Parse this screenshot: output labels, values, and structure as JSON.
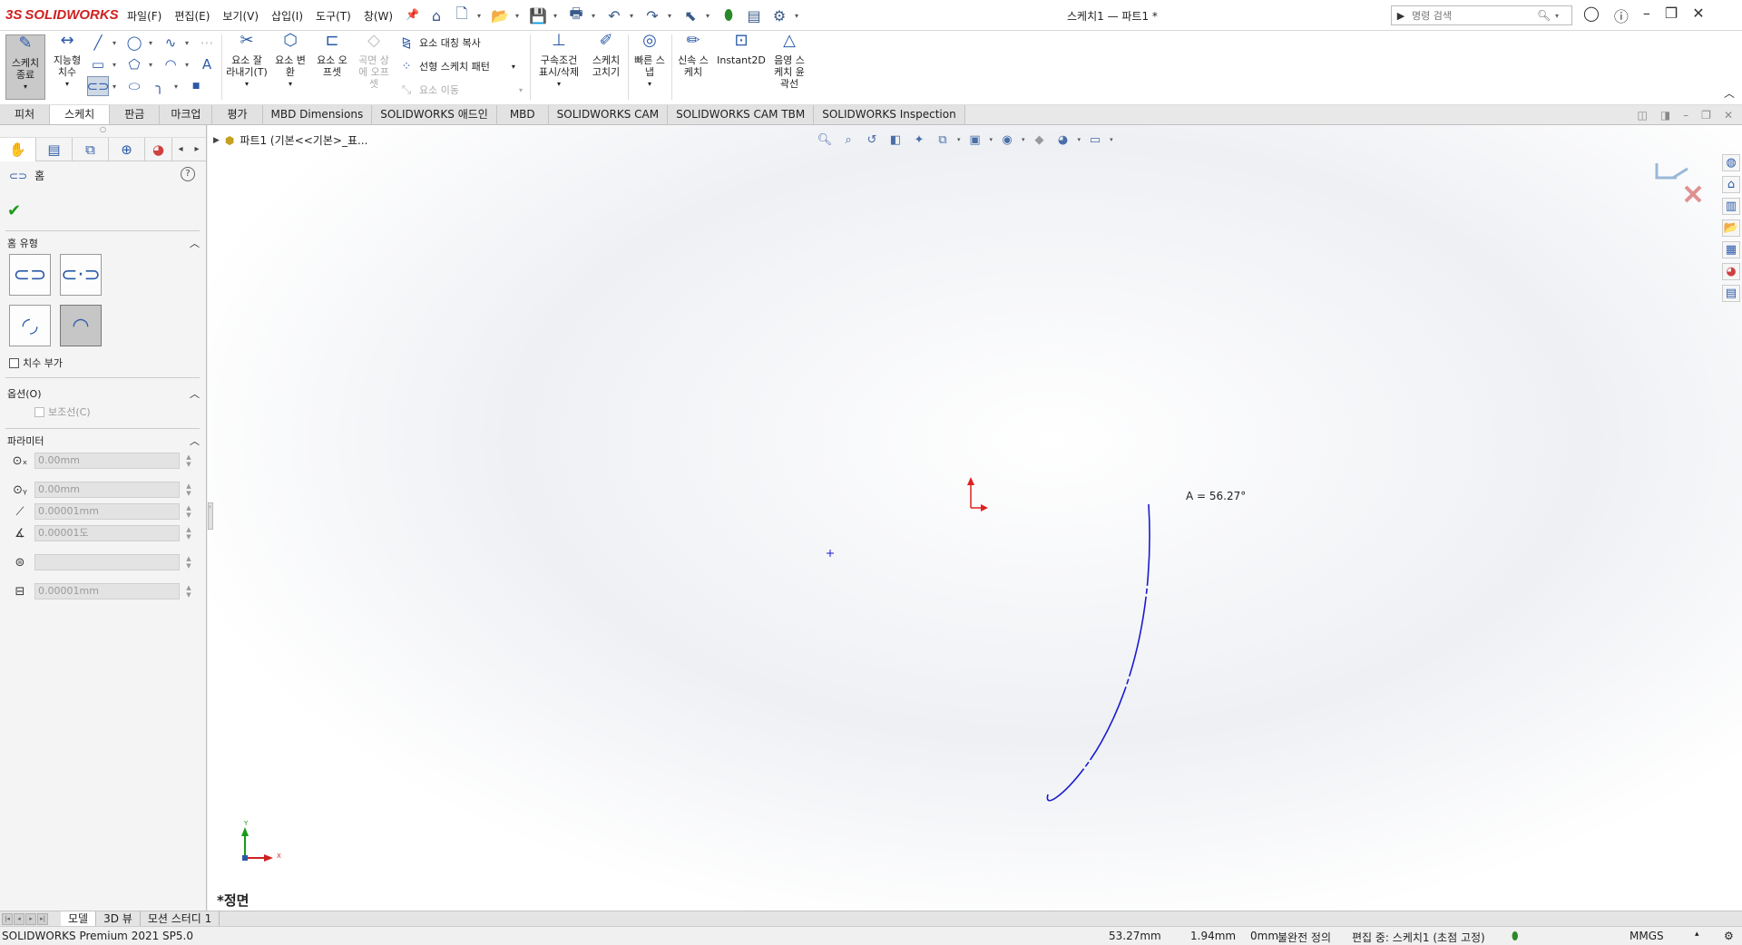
{
  "app": {
    "logo_ds": "3S",
    "logo_text": "SOLIDWORKS",
    "menus": [
      "파일(F)",
      "편집(E)",
      "보기(V)",
      "삽입(I)",
      "도구(T)",
      "창(W)"
    ],
    "document_title": "스케치1 — 파트1 *",
    "search_placeholder": "명령 검색"
  },
  "ribbon": {
    "exit_sketch": "스케치\n종료",
    "smart_dim": "지능형\n치수",
    "trim": "요소 잘\n라내기(T)",
    "convert": "요소 변\n환",
    "offset": "요소 오\n프셋",
    "surface_offset": "곡면 상\n에 오프\n셋",
    "mirror": "요소 대칭 복사",
    "linear_pattern": "선형 스케치 패턴",
    "move": "요소 이동",
    "relations": "구속조건\n표시/삭제",
    "repair": "스케치\n고치기",
    "quick_snap": "빠른 스\n냅",
    "rapid_sketch": "신속 스\n케치",
    "instant2d": "Instant2D",
    "shaded_contours": "음영 스\n케치 윤\n곽선"
  },
  "tabs": [
    "피처",
    "스케치",
    "판금",
    "마크업",
    "평가",
    "MBD Dimensions",
    "SOLIDWORKS 애드인",
    "MBD",
    "SOLIDWORKS CAM",
    "SOLIDWORKS CAM TBM",
    "SOLIDWORKS Inspection"
  ],
  "active_tab": "스케치",
  "property_manager": {
    "title": "홈",
    "help": "?",
    "ok": "✔",
    "slot_type_header": "홈 유형",
    "add_dimensions": "치수 부가",
    "options_header": "옵션(O)",
    "construction": "보조선(C)",
    "parameters_header": "파라미터",
    "params": [
      {
        "icon": "x-center-icon",
        "value": "0.00mm"
      },
      {
        "icon": "y-center-icon",
        "value": "0.00mm"
      },
      {
        "icon": "radius-icon",
        "value": "0.00001mm"
      },
      {
        "icon": "angle-icon",
        "value": "0.00001도"
      },
      {
        "icon": "width-icon",
        "value": ""
      },
      {
        "icon": "length-icon",
        "value": "0.00001mm"
      }
    ]
  },
  "graphics": {
    "breadcrumb": "파트1  (기본<<기본>_표...",
    "angle_label": "A = 56.27°",
    "view_name": "*정면",
    "triad_y": "Y",
    "triad_x": "X"
  },
  "bottom_tabs": [
    "모델",
    "3D 뷰",
    "모션 스터디 1"
  ],
  "status": {
    "edition": "SOLIDWORKS Premium 2021 SP5.0",
    "x": "53.27mm",
    "y": "1.94mm",
    "z": "0mm",
    "definition": "불완전 정의",
    "editing": "편집 중: 스케치1 (초점 고정)",
    "units": "MMGS"
  },
  "colors": {
    "sketch_line": "#1a1ad0",
    "origin_arrow": "#e02020",
    "accent_blue": "#2a5aa8"
  }
}
